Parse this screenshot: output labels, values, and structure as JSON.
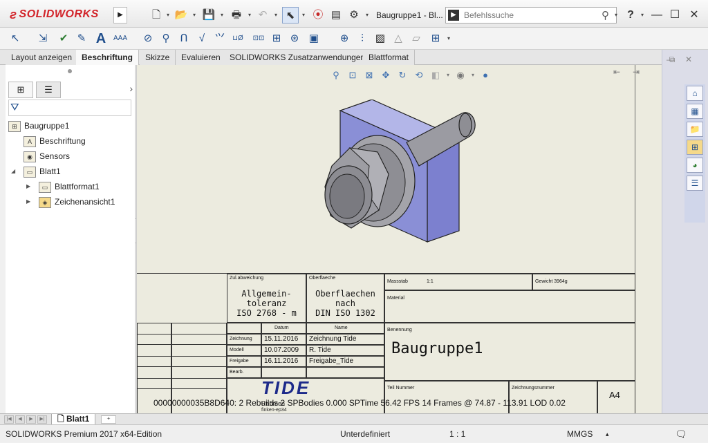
{
  "app": {
    "brand": "SOLIDWORKS",
    "doc_title": "Baugruppe1 - Bl...",
    "search_placeholder": "Befehlssuche",
    "help": "?"
  },
  "tabs": [
    {
      "label": "Layout anzeigen"
    },
    {
      "label": "Beschriftung"
    },
    {
      "label": "Skizze"
    },
    {
      "label": "Evaluieren"
    },
    {
      "label": "SOLIDWORKS Zusatzanwendungen"
    },
    {
      "label": "Blattformat"
    }
  ],
  "tree": {
    "root": "Baugruppe1",
    "items": [
      {
        "label": "Beschriftung"
      },
      {
        "label": "Sensors"
      },
      {
        "label": "Blatt1"
      },
      {
        "label": "Blattformat1"
      },
      {
        "label": "Zeichenansicht1"
      }
    ]
  },
  "titleblock": {
    "zul_abweichung_label": "Zul.abweichung",
    "tol_line1": "Allgemein-",
    "tol_line2": "toleranz",
    "tol_line3": "ISO 2768 - m",
    "oberflaeche_label": "Oberflaeche",
    "surf_line1": "Oberflaechen",
    "surf_line2": "nach",
    "surf_line3": "DIN ISO 1302",
    "massstab_label": "Massstab",
    "massstab_value": "1:1",
    "gewicht_label": "Gewicht 3964g",
    "material_label": "Material",
    "datum_label": "Datum",
    "name_label": "Name",
    "rows": [
      {
        "role": "Zeichnung",
        "date": "15.11.2016",
        "name": "Zeichnung Tide"
      },
      {
        "role": "Modell",
        "date": "10.07.2009",
        "name": "R. Tide"
      },
      {
        "role": "Freigabe",
        "date": "16.11.2016",
        "name": "Freigabe_Tide"
      },
      {
        "role": "Bearb.",
        "date": "",
        "name": ""
      }
    ],
    "benennung_label": "Benennung",
    "benennung_value": "Baugruppe1",
    "teilnummer_label": "Teil Nummer",
    "zeichnungsnummer_label": "Zeichnungsnummer",
    "format": "A4",
    "logo": "TIDE",
    "logo_sub": "Rahmen",
    "logo_sub2": "finken-ep34"
  },
  "stats_overlay": "00000000035B8D640:    2 Rebuilds    2 SPBodies  0.000 SPTime  56.42 FPS    14 Frames @ 74.87 - 113.91 LOD 0.02",
  "sheet_tab": "Blatt1",
  "status": {
    "edition": "SOLIDWORKS Premium 2017 x64-Edition",
    "state": "Unterdefiniert",
    "scale": "1 : 1",
    "units": "MMGS"
  },
  "colors": {
    "accent": "#d2242a",
    "plate": "#8a8fd6",
    "metal": "#9a9aa0"
  }
}
